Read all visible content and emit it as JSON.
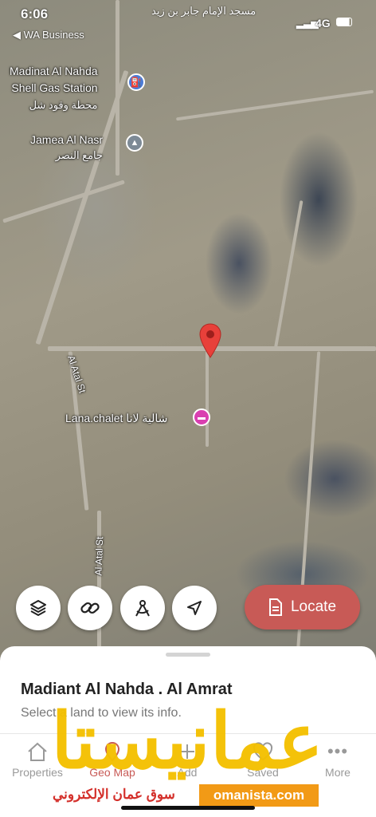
{
  "status_bar": {
    "time": "6:06",
    "back_label": "◀ WA Business",
    "network": "4G"
  },
  "map": {
    "top_label": "مسجد الإمام جابر بن زيد",
    "pois": [
      {
        "name": "Madinat Al Nahda",
        "line2": "Shell Gas Station",
        "arabic": "محطة وقود شل",
        "icon": "gas-station-icon"
      },
      {
        "name": "Jamea Al Nasr",
        "arabic": "جامع النصر",
        "icon": "mosque-icon"
      },
      {
        "name": "Lana.chalet شالية لانا",
        "icon": "hotel-icon"
      }
    ],
    "streets": [
      "Al Atal St",
      "Al Atal St"
    ],
    "pin_color": "#e8403a"
  },
  "controls": {
    "locate_label": "Locate",
    "locate_color": "#c85a56"
  },
  "sheet": {
    "title": "Madiant Al Nahda . Al Amrat",
    "subtitle": "Select a land to view its info."
  },
  "tabs": [
    {
      "label": "Properties",
      "icon": "home-icon"
    },
    {
      "label": "Geo Map",
      "icon": "map-pin-icon",
      "active": true
    },
    {
      "label": "Add",
      "icon": "add-icon"
    },
    {
      "label": "Saved",
      "icon": "heart-icon"
    },
    {
      "label": "More",
      "icon": "more-icon"
    }
  ],
  "watermark": {
    "logo": "عمانيستا",
    "arabic_text": "سوق عمان الإلكتروني",
    "url": "omanista.com"
  }
}
